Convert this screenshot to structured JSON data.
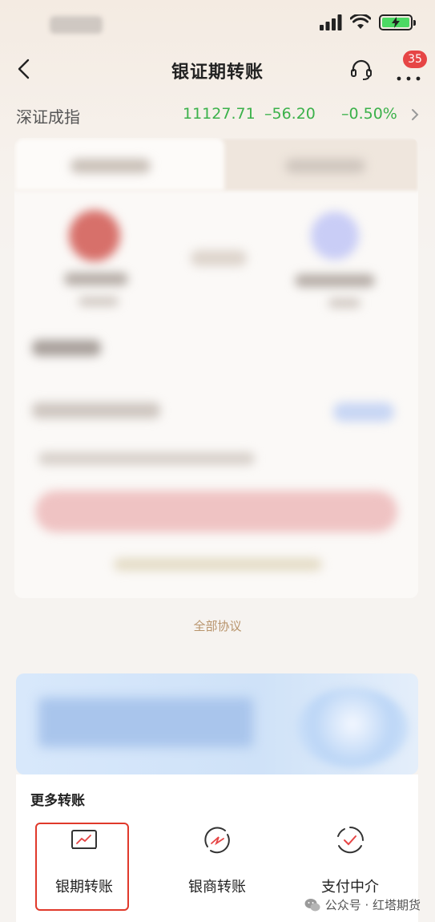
{
  "nav": {
    "title": "银证期转账",
    "badge_count": "35"
  },
  "ticker": {
    "name": "深证成指",
    "value": "11127.71",
    "change": "–56.20",
    "percent": "–0.50%",
    "color": "#3bb14a"
  },
  "protocol_link": "全部协议",
  "more_transfers": {
    "title": "更多转账",
    "items": [
      {
        "label": "银期转账",
        "icon": "chart-line-icon"
      },
      {
        "label": "银商转账",
        "icon": "arrow-circle-icon"
      },
      {
        "label": "支付中介",
        "icon": "check-circle-icon"
      }
    ]
  },
  "watermark": {
    "text": "公众号 · 红塔期货"
  },
  "colors": {
    "accent": "#e64545",
    "link": "#b8946c",
    "highlight": "#e0392b"
  }
}
